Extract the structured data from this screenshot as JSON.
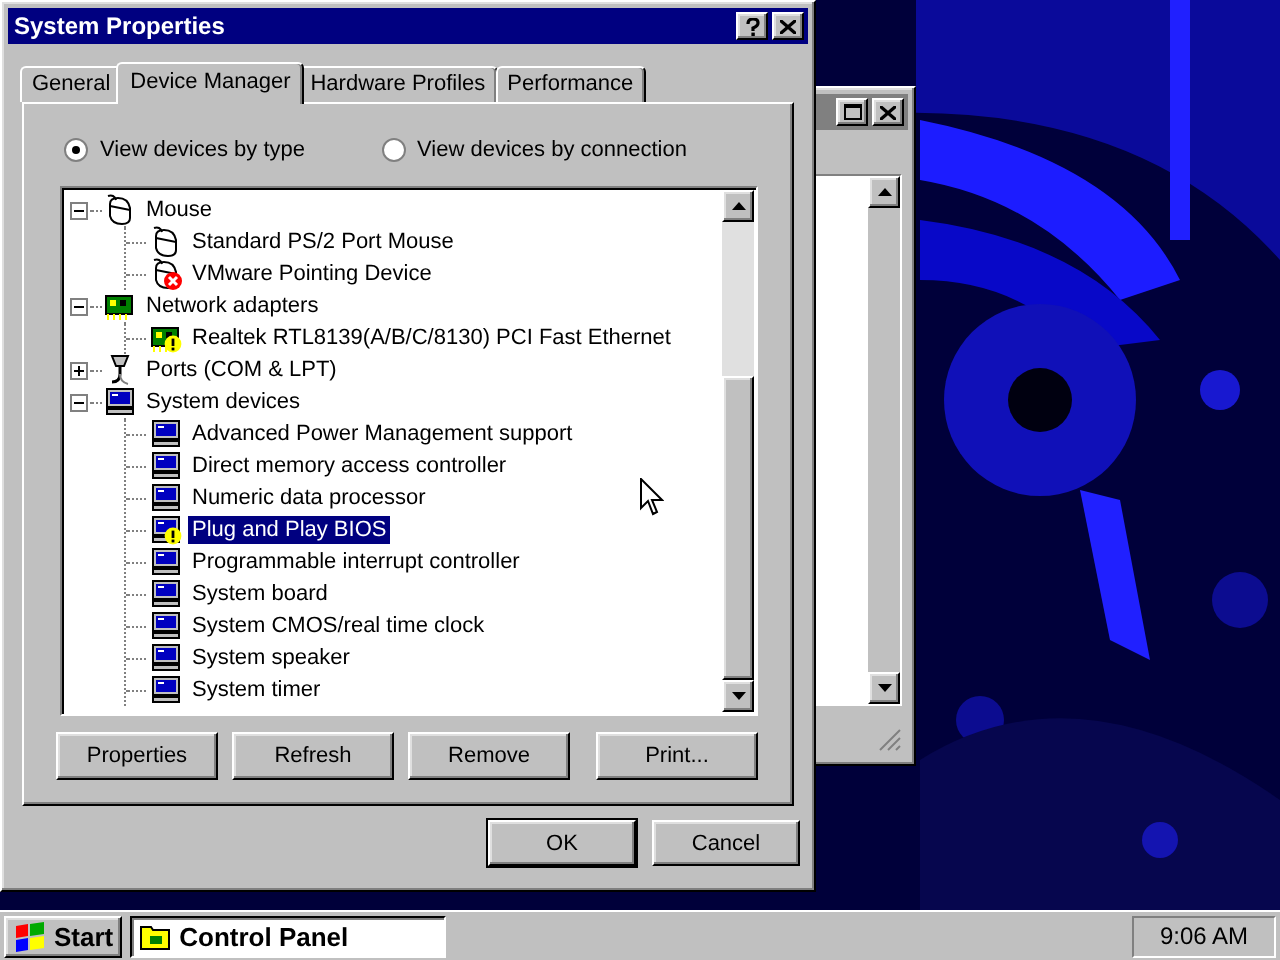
{
  "window": {
    "title": "System Properties"
  },
  "tabs": [
    {
      "label": "General",
      "selected": false
    },
    {
      "label": "Device Manager",
      "selected": true
    },
    {
      "label": "Hardware Profiles",
      "selected": false
    },
    {
      "label": "Performance",
      "selected": false
    }
  ],
  "view_options": [
    {
      "label": "View devices by type",
      "selected": true
    },
    {
      "label": "View devices by connection",
      "selected": false
    }
  ],
  "device_tree": [
    {
      "label": "Mouse",
      "kind": "mouse",
      "expanded": true,
      "selected": false,
      "children": [
        {
          "label": "Standard PS/2 Port Mouse",
          "kind": "mouse",
          "disabled": false,
          "warning": false,
          "selected": false
        },
        {
          "label": "VMware Pointing Device",
          "kind": "mouse",
          "disabled": true,
          "warning": false,
          "selected": false
        }
      ]
    },
    {
      "label": "Network adapters",
      "kind": "network",
      "expanded": true,
      "selected": false,
      "children": [
        {
          "label": "Realtek RTL8139(A/B/C/8130) PCI Fast Ethernet",
          "kind": "network",
          "disabled": false,
          "warning": true,
          "selected": false
        }
      ]
    },
    {
      "label": "Ports (COM & LPT)",
      "kind": "port",
      "expanded": false,
      "selected": false
    },
    {
      "label": "System devices",
      "kind": "computer",
      "expanded": true,
      "selected": false,
      "children": [
        {
          "label": "Advanced Power Management support",
          "kind": "computer",
          "disabled": false,
          "warning": false,
          "selected": false
        },
        {
          "label": "Direct memory access controller",
          "kind": "computer",
          "disabled": false,
          "warning": false,
          "selected": false
        },
        {
          "label": "Numeric data processor",
          "kind": "computer",
          "disabled": false,
          "warning": false,
          "selected": false
        },
        {
          "label": "Plug and Play BIOS",
          "kind": "computer",
          "disabled": false,
          "warning": true,
          "selected": true
        },
        {
          "label": "Programmable interrupt controller",
          "kind": "computer",
          "disabled": false,
          "warning": false,
          "selected": false
        },
        {
          "label": "System board",
          "kind": "computer",
          "disabled": false,
          "warning": false,
          "selected": false
        },
        {
          "label": "System CMOS/real time clock",
          "kind": "computer",
          "disabled": false,
          "warning": false,
          "selected": false
        },
        {
          "label": "System speaker",
          "kind": "computer",
          "disabled": false,
          "warning": false,
          "selected": false
        },
        {
          "label": "System timer",
          "kind": "computer",
          "disabled": false,
          "warning": false,
          "selected": false
        }
      ]
    }
  ],
  "action_buttons": [
    "Properties",
    "Refresh",
    "Remove",
    "Print..."
  ],
  "dialog_buttons": [
    {
      "label": "OK",
      "default": true
    },
    {
      "label": "Cancel",
      "default": false
    }
  ],
  "taskbar": {
    "start": "Start",
    "tasks": [
      {
        "label": "Control Panel",
        "selected": true
      }
    ],
    "clock": "9:06 AM"
  }
}
